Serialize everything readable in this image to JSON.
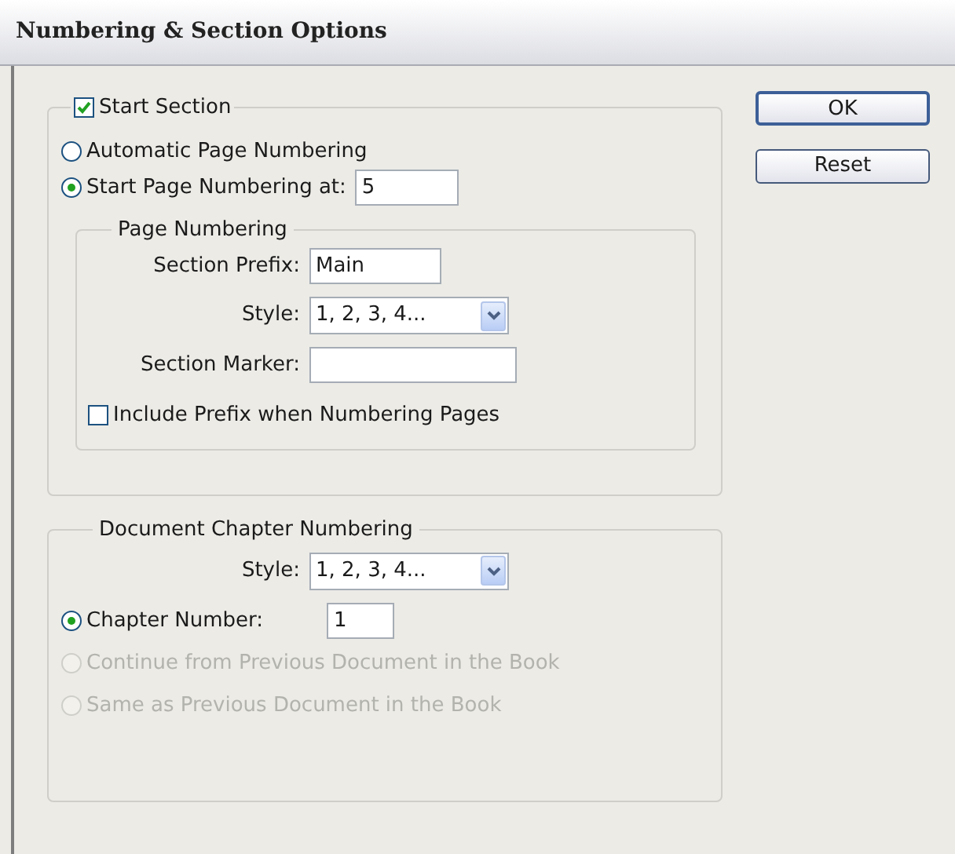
{
  "window": {
    "title": "Numbering & Section Options"
  },
  "start_section": {
    "label": "Start Section",
    "checked": true,
    "options": [
      {
        "label": "Automatic Page Numbering",
        "selected": false
      },
      {
        "label": "Start Page Numbering at:",
        "selected": true,
        "value": "5"
      }
    ],
    "page_numbering": {
      "title": "Page Numbering",
      "fields": [
        {
          "kind": "text",
          "label": "Section Prefix:",
          "value": "Main"
        },
        {
          "kind": "select",
          "label": "Style:",
          "value": "1, 2, 3, 4..."
        },
        {
          "kind": "text",
          "label": "Section Marker:"
        }
      ],
      "include_prefix": {
        "label": "Include Prefix when Numbering Pages",
        "checked": false
      }
    }
  },
  "chapter_numbering": {
    "title": "Document Chapter Numbering",
    "style": {
      "label": "Style:",
      "value": "1, 2, 3, 4..."
    },
    "options": [
      {
        "label": "Chapter Number:",
        "selected": true,
        "disabled": false,
        "value": "1"
      },
      {
        "label": "Continue from Previous Document in the Book",
        "selected": false,
        "disabled": true
      },
      {
        "label": "Same as Previous Document in the Book",
        "selected": false,
        "disabled": true
      }
    ]
  },
  "buttons": [
    {
      "label": "OK",
      "default": true
    },
    {
      "label": "Reset",
      "default": false
    }
  ]
}
